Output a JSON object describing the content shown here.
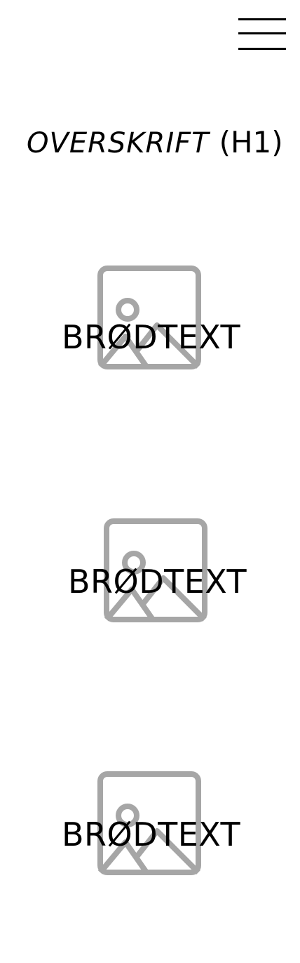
{
  "header": {
    "menu_icon": "hamburger-menu-icon",
    "title_main": "OVERSKRIFT",
    "title_suffix": "(H1)"
  },
  "blocks": [
    {
      "image_icon": "image-placeholder-icon",
      "text": "BRØDTEXT"
    },
    {
      "image_icon": "image-placeholder-icon",
      "text": "BRØDTEXT"
    },
    {
      "image_icon": "image-placeholder-icon",
      "text": "BRØDTEXT"
    }
  ],
  "colors": {
    "text": "#000000",
    "placeholder": "#a6a6a6",
    "background": "#ffffff"
  }
}
